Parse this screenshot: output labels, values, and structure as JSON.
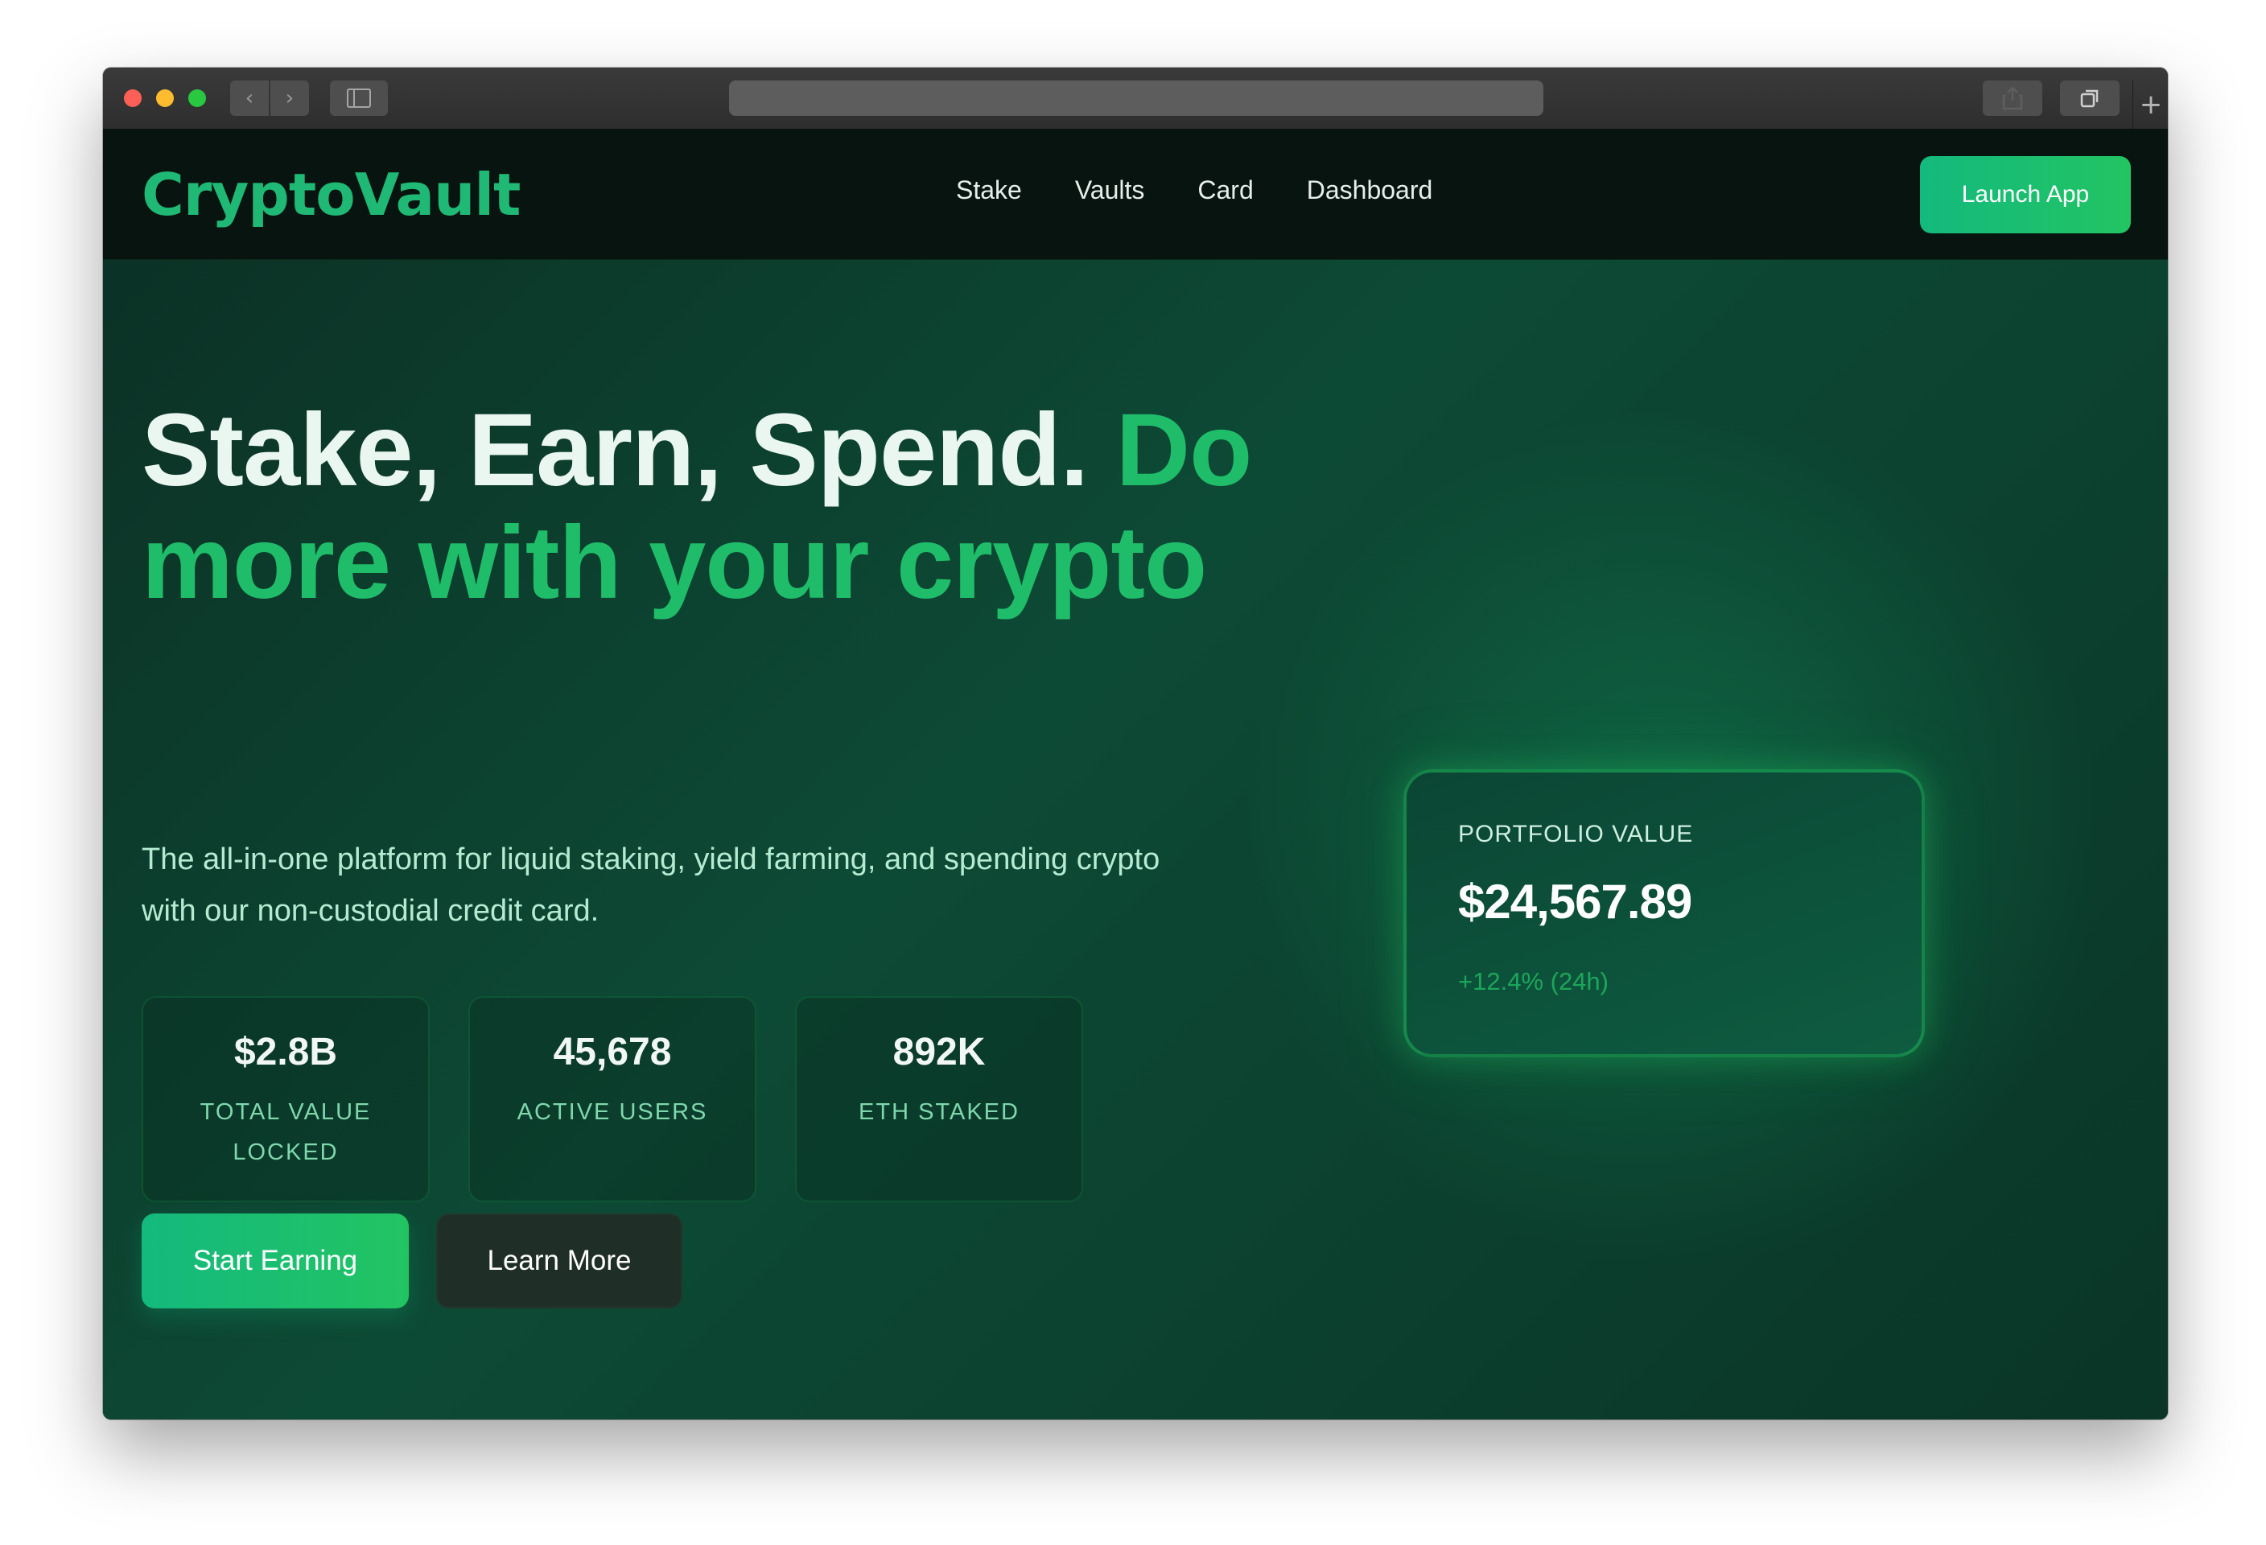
{
  "browser": {
    "back_glyph": "‹",
    "forward_glyph": "›",
    "new_tab_glyph": "+",
    "icons": [
      "sidebar-icon",
      "share-icon",
      "tabs-icon",
      "plus-icon"
    ]
  },
  "nav": {
    "logo": "CryptoVault",
    "links": [
      "Stake",
      "Vaults",
      "Card",
      "Dashboard"
    ],
    "cta": "Launch App"
  },
  "hero": {
    "headline_main": "Stake, Earn, Spend.",
    "headline_accent": "Do more with your crypto",
    "subtitle": "The all-in-one platform for liquid staking, yield farming, and spending crypto with our non-custodial credit card.",
    "stats": [
      {
        "value": "$2.8B",
        "label": "TOTAL VALUE LOCKED"
      },
      {
        "value": "45,678",
        "label": "ACTIVE USERS"
      },
      {
        "value": "892K",
        "label": "ETH STAKED"
      }
    ],
    "primary_button": "Start Earning",
    "secondary_button": "Learn More"
  },
  "portfolio": {
    "label": "PORTFOLIO VALUE",
    "value": "$24,567.89",
    "change": "+12.4% (24h)"
  },
  "colors": {
    "accent": "#1fbd6a",
    "button_gradient_start": "#14b97d",
    "button_gradient_end": "#22c462",
    "nav_background": "#08140f",
    "page_background": "#0d4a35"
  }
}
